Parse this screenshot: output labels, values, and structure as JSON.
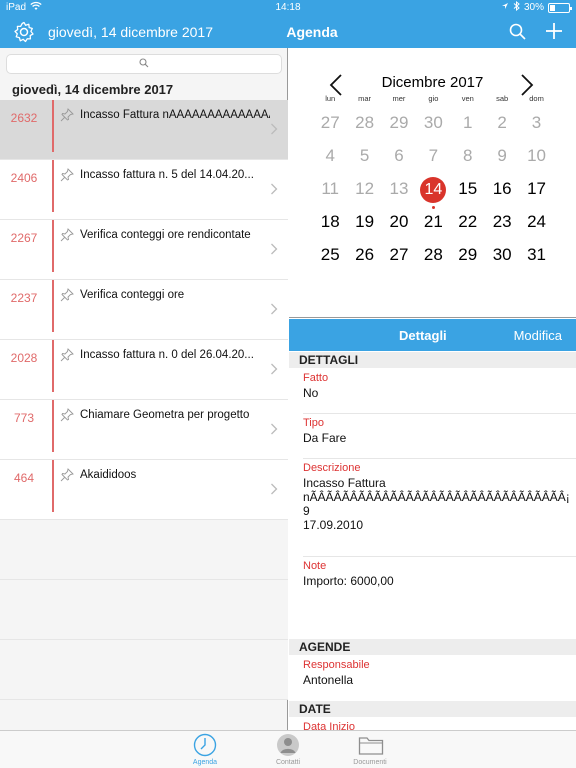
{
  "status": {
    "carrier": "iPad",
    "time": "14:18",
    "battery": "30%",
    "battery_level": 0.3
  },
  "nav": {
    "date": "giovedì, 14 dicembre 2017",
    "title": "Agenda"
  },
  "list": {
    "section_date": "giovedì, 14 dicembre 2017",
    "items": [
      {
        "number": "2632",
        "title": "Incasso Fattura nÃÂÃÂÃÂÃÂÃÂÃÂÃÂÃÂ",
        "selected": true
      },
      {
        "number": "2406",
        "title": "Incasso fattura n. 5 del 14.04.20...",
        "selected": false
      },
      {
        "number": "2267",
        "title": "Verifica conteggi ore rendicontate",
        "selected": false
      },
      {
        "number": "2237",
        "title": "Verifica conteggi ore",
        "selected": false
      },
      {
        "number": "2028",
        "title": "Incasso fattura n. 0 del 26.04.20...",
        "selected": false
      },
      {
        "number": "773",
        "title": "Chiamare Geometra per progetto",
        "selected": false
      },
      {
        "number": "464",
        "title": "Akaididoos",
        "selected": false
      }
    ]
  },
  "calendar": {
    "month": "Dicembre 2017",
    "weekdays": [
      "lun",
      "mar",
      "mer",
      "gio",
      "ven",
      "sab",
      "dom"
    ],
    "weeks": [
      [
        {
          "d": "27",
          "m": true
        },
        {
          "d": "28",
          "m": true
        },
        {
          "d": "29",
          "m": true
        },
        {
          "d": "30",
          "m": true
        },
        {
          "d": "1",
          "m": true
        },
        {
          "d": "2",
          "m": true
        },
        {
          "d": "3",
          "m": true
        }
      ],
      [
        {
          "d": "4",
          "m": true
        },
        {
          "d": "5",
          "m": true
        },
        {
          "d": "6",
          "m": true
        },
        {
          "d": "7",
          "m": true
        },
        {
          "d": "8",
          "m": true
        },
        {
          "d": "9",
          "m": true
        },
        {
          "d": "10",
          "m": true
        }
      ],
      [
        {
          "d": "11",
          "m": true
        },
        {
          "d": "12",
          "m": true
        },
        {
          "d": "13",
          "m": true
        },
        {
          "d": "14",
          "today": true
        },
        {
          "d": "15"
        },
        {
          "d": "16"
        },
        {
          "d": "17"
        }
      ],
      [
        {
          "d": "18"
        },
        {
          "d": "19"
        },
        {
          "d": "20"
        },
        {
          "d": "21"
        },
        {
          "d": "22"
        },
        {
          "d": "23"
        },
        {
          "d": "24"
        }
      ],
      [
        {
          "d": "25"
        },
        {
          "d": "26"
        },
        {
          "d": "27"
        },
        {
          "d": "28"
        },
        {
          "d": "29"
        },
        {
          "d": "30"
        },
        {
          "d": "31"
        }
      ]
    ]
  },
  "detail": {
    "title": "Dettagli",
    "edit": "Modifica",
    "section_details": "DETTAGLI",
    "fatto_label": "Fatto",
    "fatto_value": "No",
    "tipo_label": "Tipo",
    "tipo_value": "Da Fare",
    "descrizione_label": "Descrizione",
    "descrizione_value": "Incasso Fattura\nnÃÂÃÂÃÂÃÂÃÂÃÂÃÂÃÂÃÂÃÂÃÂÃÂÃÂÃÂÃÂÃÂ¡ 9\n17.09.2010",
    "note_label": "Note",
    "note_value": "Importo: 6000,00",
    "section_agende": "AGENDE",
    "responsabile_label": "Responsabile",
    "responsabile_value": "Antonella",
    "section_date": "DATE",
    "data_inizio_label": "Data Inizio"
  },
  "tabbar": {
    "agenda": "Agenda",
    "contatti": "Contatti",
    "documenti": "Documenti"
  },
  "colors": {
    "accent": "#3aa3e3",
    "today": "#d9342b",
    "number": "#e06a6a"
  }
}
